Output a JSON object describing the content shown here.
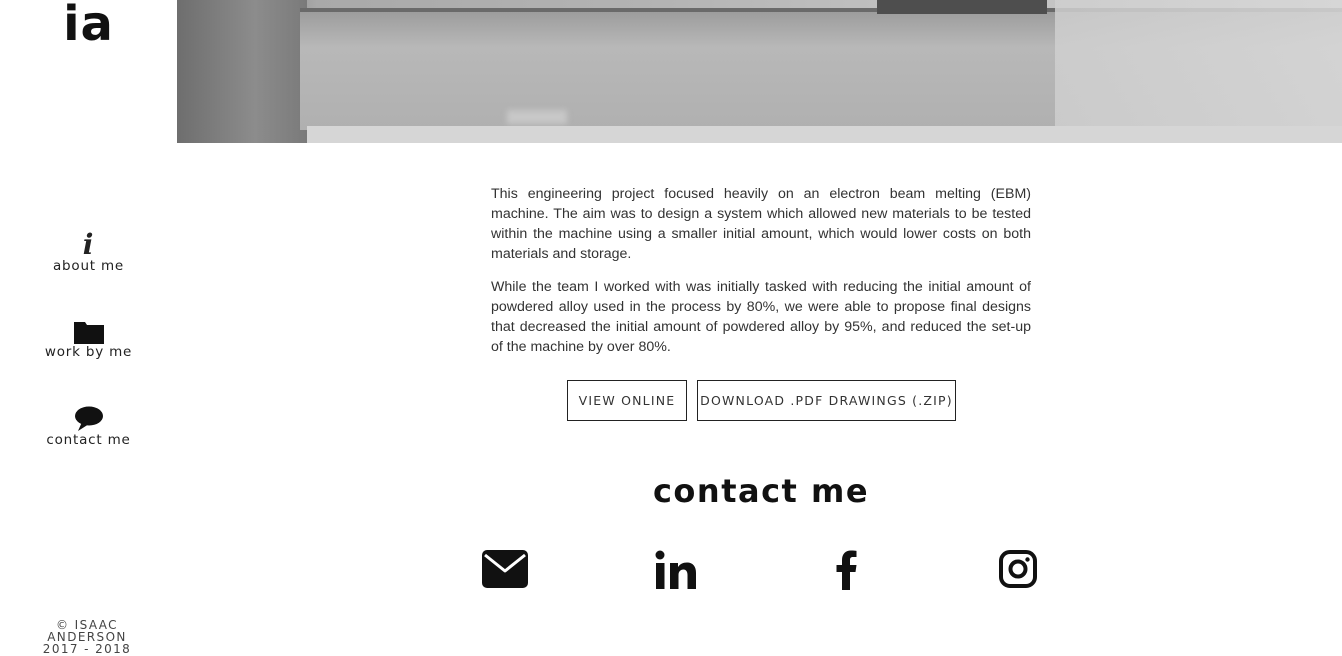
{
  "sidebar": {
    "logo": "ia",
    "nav": [
      {
        "label": "about me",
        "icon": "info-icon"
      },
      {
        "label": "work by me",
        "icon": "folder-icon"
      },
      {
        "label": "contact me",
        "icon": "speech-bubble-icon"
      }
    ],
    "info_glyph": "i",
    "copyright_line1": "© ISAAC ANDERSON",
    "copyright_line2": "2017 - 2018"
  },
  "main": {
    "paragraphs": [
      "This engineering project focused heavily on an electron beam melting (EBM) machine. The aim was to design a system which allowed new materials to be tested within the machine using a smaller initial amount, which would lower costs on both materials and storage.",
      "While the team I worked with was initially tasked with reducing the initial amount of powdered alloy used in the process by 80%, we were able to propose final designs that decreased the initial amount of powdered alloy by 95%, and reduced the set-up of the machine by over 80%."
    ],
    "buttons": {
      "view_online": "VIEW ONLINE",
      "download": "DOWNLOAD .PDF DRAWINGS (.ZIP)"
    }
  },
  "contact": {
    "heading": "contact me",
    "social": [
      {
        "name": "email",
        "icon": "envelope-icon"
      },
      {
        "name": "linkedin",
        "icon": "linkedin-icon"
      },
      {
        "name": "facebook",
        "icon": "facebook-icon"
      },
      {
        "name": "instagram",
        "icon": "instagram-icon"
      }
    ]
  },
  "colors": {
    "text": "#111111",
    "body_text": "#333333",
    "background": "#ffffff"
  }
}
